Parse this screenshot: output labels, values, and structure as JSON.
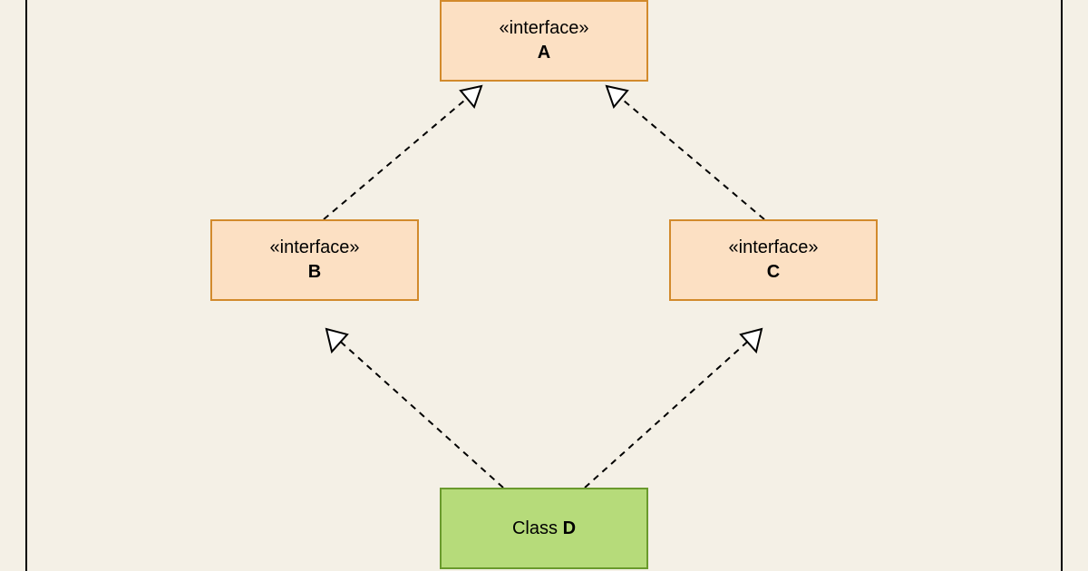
{
  "diagram": {
    "nodes": {
      "a": {
        "stereotype": "«interface»",
        "name": "A",
        "kind": "interface"
      },
      "b": {
        "stereotype": "«interface»",
        "name": "B",
        "kind": "interface"
      },
      "c": {
        "stereotype": "«interface»",
        "name": "C",
        "kind": "interface"
      },
      "d": {
        "label_prefix": "Class ",
        "name": "D",
        "kind": "class"
      }
    },
    "edges": [
      {
        "from": "b",
        "to": "a",
        "type": "realization"
      },
      {
        "from": "c",
        "to": "a",
        "type": "realization"
      },
      {
        "from": "d",
        "to": "b",
        "type": "realization"
      },
      {
        "from": "d",
        "to": "c",
        "type": "realization"
      }
    ],
    "colors": {
      "interface_fill": "#fce0c3",
      "interface_border": "#d28a2c",
      "class_fill": "#b6db7a",
      "class_border": "#6a9a2d",
      "canvas_bg": "#f4f0e6",
      "frame_border": "#000000"
    }
  }
}
